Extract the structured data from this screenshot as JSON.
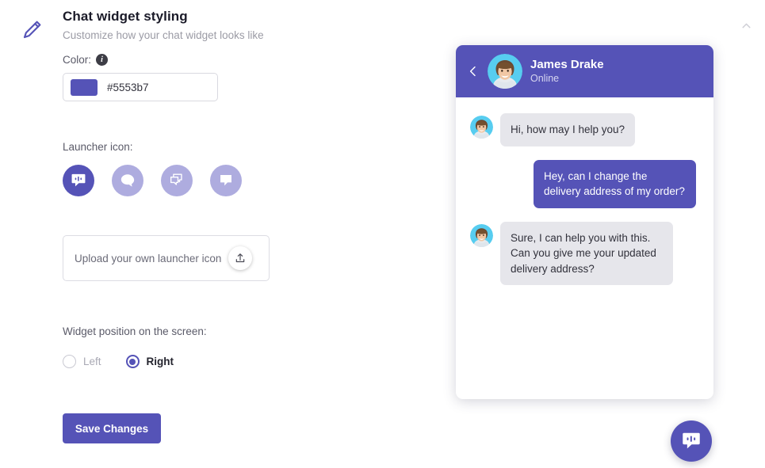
{
  "header": {
    "edit_icon": "pencil-icon",
    "collapse_icon": "chevron-up-icon",
    "title": "Chat widget styling",
    "subtitle": "Customize how your chat widget looks like"
  },
  "color_field": {
    "label": "Color:",
    "info_icon": "info-icon",
    "info_glyph": "i",
    "value": "#5553b7",
    "swatch_color": "#5553b7"
  },
  "launcher": {
    "label": "Launcher icon:",
    "options": [
      {
        "icon": "chat-bubble-voice-icon",
        "selected": true
      },
      {
        "icon": "chat-bubble-round-icon",
        "selected": false
      },
      {
        "icon": "chat-bubbles-stacked-icon",
        "selected": false
      },
      {
        "icon": "chat-bubble-square-icon",
        "selected": false
      }
    ],
    "selected_color": "#5553b7",
    "unselected_color": "#aeacdf"
  },
  "upload": {
    "text": "Upload your own launcher icon",
    "button_icon": "upload-icon"
  },
  "position": {
    "label": "Widget position on the screen:",
    "options": [
      {
        "label": "Left",
        "selected": false
      },
      {
        "label": "Right",
        "selected": true
      }
    ]
  },
  "save": {
    "label": "Save Changes"
  },
  "preview": {
    "back_icon": "chevron-left-icon",
    "agent_name": "James Drake",
    "agent_status": "Online",
    "avatar_icon": "avatar-photo",
    "messages": [
      {
        "from": "agent",
        "text": "Hi, how may I help you?"
      },
      {
        "from": "user",
        "text": "Hey, can I change the delivery address of my order?"
      },
      {
        "from": "agent",
        "text": "Sure, I can help you with this. Can you give me your updated delivery address?"
      }
    ]
  },
  "fab": {
    "icon": "chat-bubble-voice-icon"
  }
}
